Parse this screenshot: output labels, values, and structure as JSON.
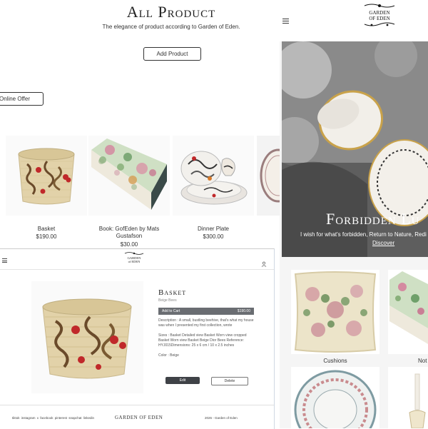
{
  "all_product": {
    "title": "All Product",
    "subtitle": "The elegance of product according to Garden of Eden.",
    "add_product_label": "Add Product",
    "online_offer_label": "Online Offer",
    "products": [
      {
        "name": "Basket",
        "price": "$190.00"
      },
      {
        "name": "Book: GofEden by Mats Gustafson",
        "price": "$30.00"
      },
      {
        "name": "Dinner Plate",
        "price": "$300.00"
      }
    ]
  },
  "detail": {
    "logo_line1": "GARDEN",
    "logo_line2": "of EDEN",
    "title": "Basket",
    "subtitle": "Beige Bees",
    "add_to_cart_label": "Add to Cart",
    "price": "$190.00",
    "description": "Description : A small, bustling beehive, that's what my house was when I presented my first collection, wrote",
    "sizes": "Sizes : Basket Detailed view Basket Worn view cropped Basket Worn view Basket Beige Dior Bees Reference: HYJ015Dimensions: 25 x 6 cm / 10 x 2.5 inches",
    "color": "Color : Beige",
    "edit_label": "Edit",
    "delete_label": "Delete",
    "footer_social": "tiktok  instagram  x  facebook  pinterest  snapchat  linkedin",
    "footer_logo": "GARDEN OF EDEN",
    "footer_copy": "2026 -  Garden of Eden"
  },
  "right": {
    "logo_line1": "GARDEN",
    "logo_line2": "OF EDEN",
    "hero_title": "Forbidden Lu",
    "hero_subtitle": "I wish for what's forbidden, Return to Nature, Redi",
    "hero_link": "Discover",
    "categories": [
      {
        "label": "Cushions"
      },
      {
        "label": "Not"
      }
    ]
  },
  "colors": {
    "dark_button": "#3f4247",
    "add_to_cart_bar": "#6a6d72",
    "accent_red": "#c0282a",
    "basket_tan": "#e0cfa6"
  },
  "icons": [
    "hamburger-icon",
    "user-icon",
    "logo-ornament-icon"
  ]
}
